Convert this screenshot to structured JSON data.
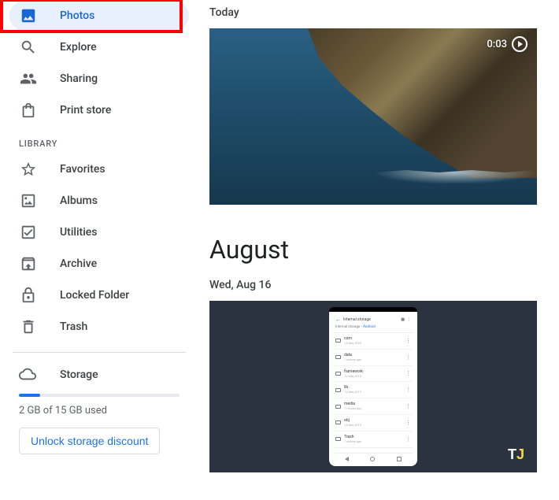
{
  "sidebar": {
    "nav": [
      {
        "label": "Photos",
        "icon": "image"
      },
      {
        "label": "Explore",
        "icon": "search"
      },
      {
        "label": "Sharing",
        "icon": "people"
      },
      {
        "label": "Print store",
        "icon": "shopping-bag"
      }
    ],
    "library_header": "LIBRARY",
    "library": [
      {
        "label": "Favorites",
        "icon": "star"
      },
      {
        "label": "Albums",
        "icon": "bookmark-album"
      },
      {
        "label": "Utilities",
        "icon": "check-box"
      },
      {
        "label": "Archive",
        "icon": "archive"
      },
      {
        "label": "Locked Folder",
        "icon": "lock"
      },
      {
        "label": "Trash",
        "icon": "trash"
      }
    ],
    "storage": {
      "label": "Storage",
      "used_text": "2 GB of 15 GB used",
      "discount_btn": "Unlock storage discount"
    }
  },
  "main": {
    "today_label": "Today",
    "video_duration": "0:03",
    "month_header": "August",
    "date2_label": "Wed, Aug 16",
    "phone": {
      "title": "Internal storage",
      "path_pre": "Internal storage",
      "path_sep": "›",
      "path_cur": "Android",
      "rows": [
        {
          "name": "com",
          "sub": "14 May 2020"
        },
        {
          "name": "data",
          "sub": "1 minute ago"
        },
        {
          "name": "framework",
          "sub": "14 May 2019"
        },
        {
          "name": "lib",
          "sub": "14 May 2019"
        },
        {
          "name": "media",
          "sub": "11 hours ago"
        },
        {
          "name": "obj",
          "sub": "14 May 2019"
        },
        {
          "name": "Trash",
          "sub": "1 minute ago"
        }
      ]
    },
    "badge": {
      "t": "T",
      "j": "J"
    }
  }
}
